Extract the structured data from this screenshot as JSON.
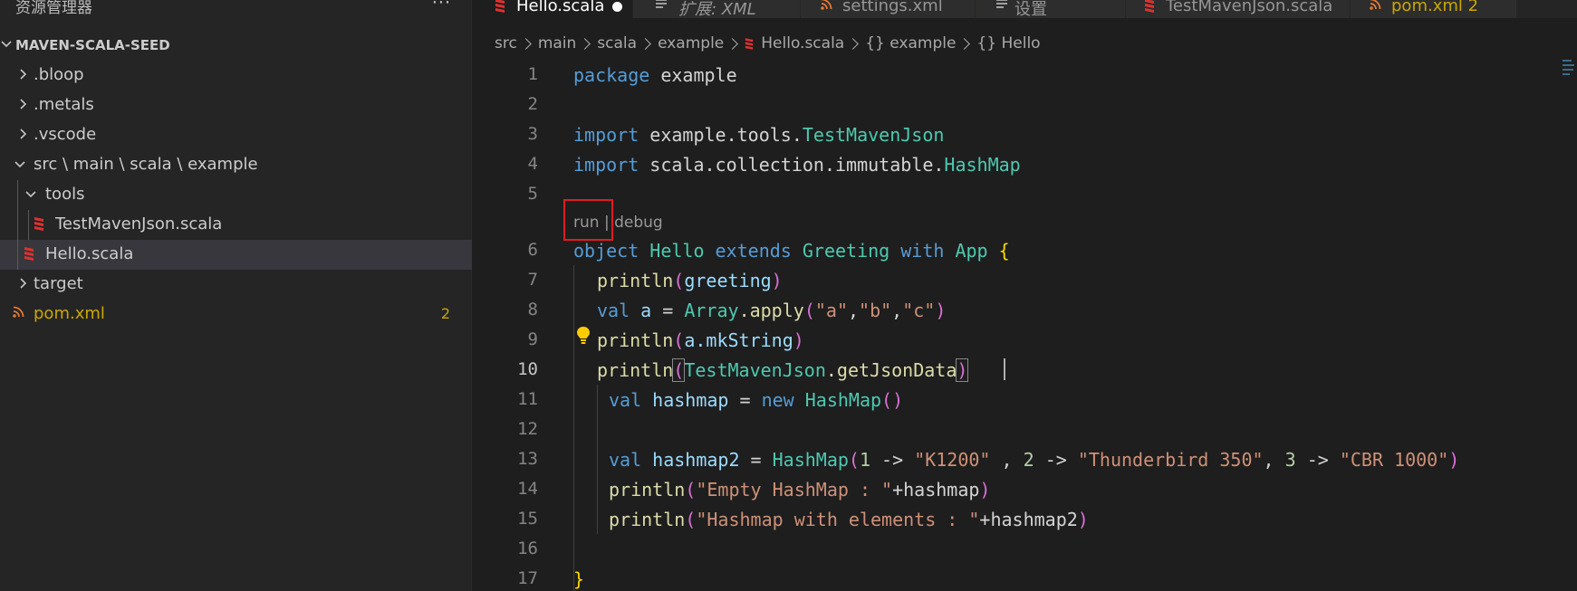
{
  "sidebar": {
    "title": "资源管理器",
    "more": "···",
    "project": "MAVEN-SCALA-SEED",
    "items": [
      {
        "label": ".bloop"
      },
      {
        "label": ".metals"
      },
      {
        "label": ".vscode"
      },
      {
        "label": "src \\ main \\ scala \\ example"
      },
      {
        "label": "tools"
      },
      {
        "label": "TestMavenJson.scala"
      },
      {
        "label": "Hello.scala"
      },
      {
        "label": "target"
      },
      {
        "label": "pom.xml",
        "badge": "2"
      }
    ]
  },
  "tabs": [
    {
      "label": "Hello.scala"
    },
    {
      "label": "扩展: XML"
    },
    {
      "label": "settings.xml"
    },
    {
      "label": "设置"
    },
    {
      "label": "TestMavenJson.scala"
    },
    {
      "label": "pom.xml",
      "badge": "2"
    }
  ],
  "breadcrumb": [
    "src",
    "main",
    "scala",
    "example",
    "Hello.scala",
    "{} example",
    "{} Hello"
  ],
  "codelens": {
    "run": "run",
    "sep": "|",
    "debug": "debug"
  },
  "line_numbers": [
    "1",
    "2",
    "3",
    "4",
    "5",
    "6",
    "7",
    "8",
    "9",
    "10",
    "11",
    "12",
    "13",
    "14",
    "15",
    "16",
    "17"
  ],
  "code": {
    "l1": {
      "kw": "package",
      "rest": " example"
    },
    "l3": {
      "kw": "import",
      "path": " example.tools.",
      "type": "TestMavenJson"
    },
    "l4": {
      "kw": "import",
      "path": " scala.collection.immutable.",
      "type": "HashMap"
    },
    "l6": {
      "kw": "object",
      "name": " Hello",
      "ext": " extends",
      "t1": " Greeting",
      "with": " with",
      "t2": " App",
      "brace": " {"
    },
    "l7": {
      "fn": "println",
      "p1": "(",
      "arg": "greeting",
      "p2": ")"
    },
    "l8": {
      "kw": "val",
      "name": " a",
      "eq": " = ",
      "type": "Array",
      "call": ".apply",
      "p1": "(",
      "s1": "\"a\"",
      "c1": ",",
      "s2": "\"b\"",
      "c2": ",",
      "s3": "\"c\"",
      "p2": ")"
    },
    "l9": {
      "fn": "println",
      "p1": "(",
      "arg": "a.mkString",
      "p2": ")"
    },
    "l10": {
      "fn": "println",
      "p1": "(",
      "type": "TestMavenJson",
      "call": ".getJsonData",
      "p2": ")"
    },
    "l11": {
      "kw": "val",
      "name": " hashmap",
      "eq": " = ",
      "new": "new",
      "type": " HashMap",
      "p": "()"
    },
    "l13": {
      "kw": "val",
      "name": " hashmap2",
      "eq": " = ",
      "type": "HashMap",
      "p1": "(",
      "n1": "1",
      "a1": " -> ",
      "s1": "\"K1200\"",
      "c1": " , ",
      "n2": "2",
      "a2": " -> ",
      "s2": "\"Thunderbird 350\"",
      "c2": ", ",
      "n3": "3",
      "a3": " -> ",
      "s3": "\"CBR 1000\"",
      "p2": ")"
    },
    "l14": {
      "fn": "println",
      "p1": "(",
      "s": "\"Empty HashMap : \"",
      "rest": "+hashmap",
      "p2": ")"
    },
    "l15": {
      "fn": "println",
      "p1": "(",
      "s": "\"Hashmap with elements : \"",
      "rest": "+hashmap2",
      "p2": ")"
    },
    "l17": {
      "brace": "}"
    }
  },
  "colors": {
    "accent_badge": "#cca700",
    "scala_icon": "#e0312f",
    "highlight_box": "#e01b24"
  }
}
